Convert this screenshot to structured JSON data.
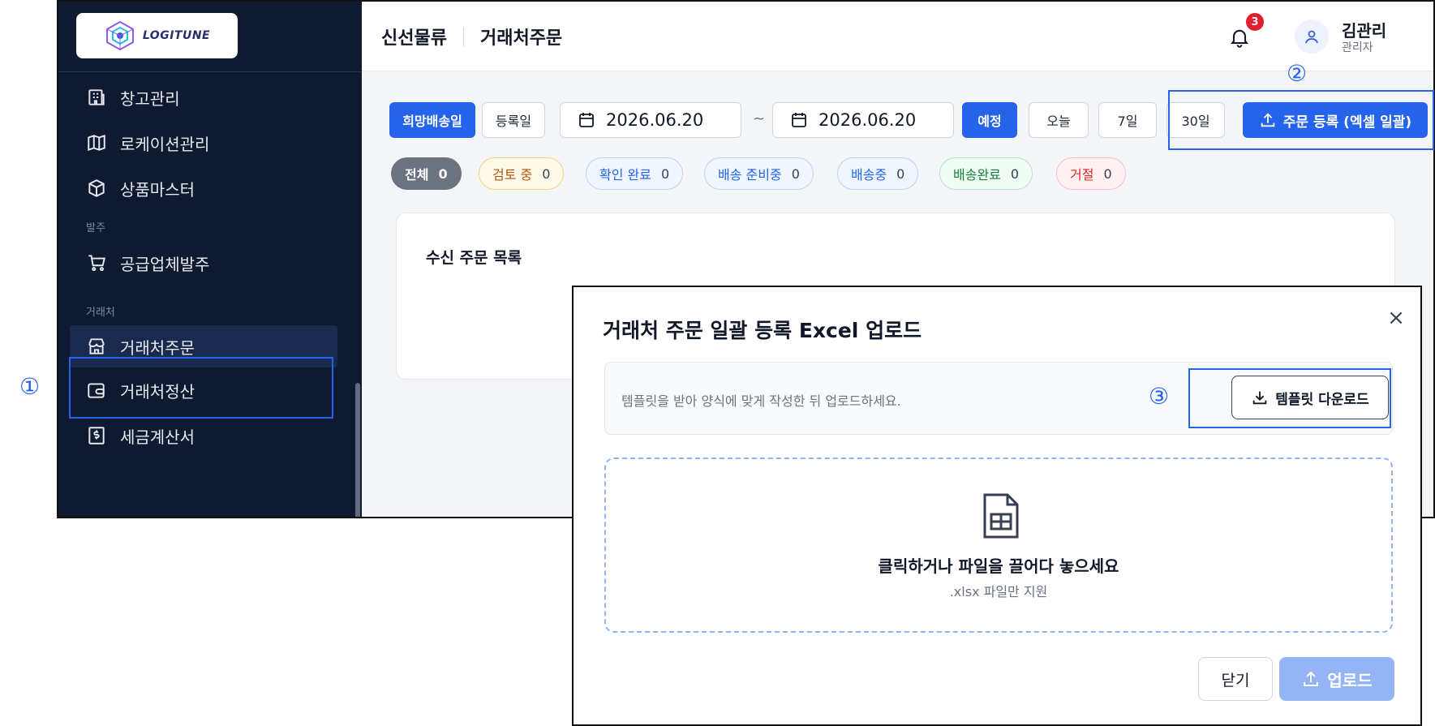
{
  "sidebar": {
    "logo_text": "LOGITUNE",
    "items": [
      {
        "label": "창고관리",
        "icon": "warehouse-icon"
      },
      {
        "label": "로케이션관리",
        "icon": "map-icon"
      },
      {
        "label": "상품마스터",
        "icon": "box-icon"
      },
      {
        "label": "공급업체발주",
        "icon": "cart-icon"
      },
      {
        "label": "거래처주문",
        "icon": "store-icon"
      },
      {
        "label": "거래처정산",
        "icon": "wallet-icon"
      },
      {
        "label": "세금계산서",
        "icon": "invoice-icon"
      }
    ],
    "sections": {
      "order": "발주",
      "client": "거래처"
    }
  },
  "header": {
    "breadcrumb_company": "신선물류",
    "breadcrumb_page": "거래처주문",
    "notification_count": "3",
    "user_name": "김관리",
    "user_role": "관리자"
  },
  "filters": {
    "date_type_selected": "희망배송일",
    "date_type_other": "등록일",
    "start_date": "2026.06.20",
    "tilde": "~",
    "end_date": "2026.06.20",
    "presets": [
      "예정",
      "오늘",
      "7일",
      "30일"
    ],
    "upload_button": "주문 등록 (엑셀 일괄)"
  },
  "status_pills": [
    {
      "label": "전체",
      "count": "0"
    },
    {
      "label": "검토 중",
      "count": "0"
    },
    {
      "label": "확인 완료",
      "count": "0"
    },
    {
      "label": "배송 준비중",
      "count": "0"
    },
    {
      "label": "배송중",
      "count": "0"
    },
    {
      "label": "배송완료",
      "count": "0"
    },
    {
      "label": "거절",
      "count": "0"
    }
  ],
  "list": {
    "title": "수신 주문 목록"
  },
  "annotations": [
    "①",
    "②",
    "③"
  ],
  "modal": {
    "title": "거래처 주문 일괄 등록 Excel 업로드",
    "close_icon": "×",
    "template_hint": "템플릿을 받아 양식에 맞게 작성한 뒤 업로드하세요.",
    "template_button": "템플릿 다운로드",
    "drop_main": "클릭하거나 파일을 끌어다 놓으세요",
    "drop_sub": ".xlsx 파일만 지원",
    "close_button": "닫기",
    "upload_button": "업로드"
  },
  "colors": {
    "primary": "#2563eb",
    "sidebar_bg": "#0f1a30",
    "badge": "#e11d2e",
    "annotation": "#2563eb"
  }
}
